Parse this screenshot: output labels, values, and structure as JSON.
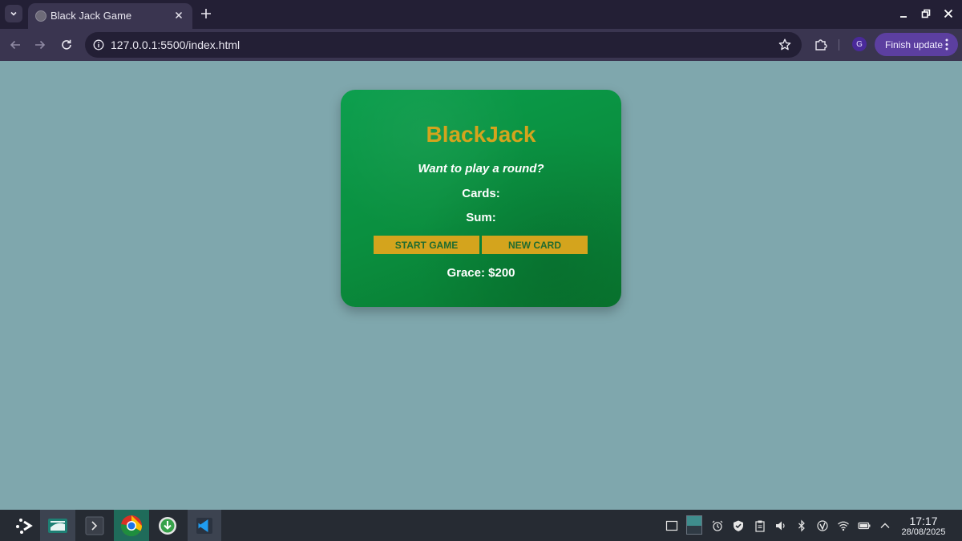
{
  "browser": {
    "tab_title": "Black Jack Game",
    "url": "127.0.0.1:5500/index.html",
    "profile_initial": "G",
    "update_label": "Finish update"
  },
  "game": {
    "title": "BlackJack",
    "message": "Want to play a round?",
    "cards_label": "Cards:",
    "sum_label": "Sum:",
    "start_button": "START GAME",
    "new_card_button": "NEW CARD",
    "player": "Grace: $200"
  },
  "taskbar": {
    "time": "17:17",
    "date": "28/08/2025"
  },
  "colors": {
    "page_bg": "#7fa7ad",
    "table_green": "#0a8f3f",
    "gold": "#d4a41d"
  }
}
